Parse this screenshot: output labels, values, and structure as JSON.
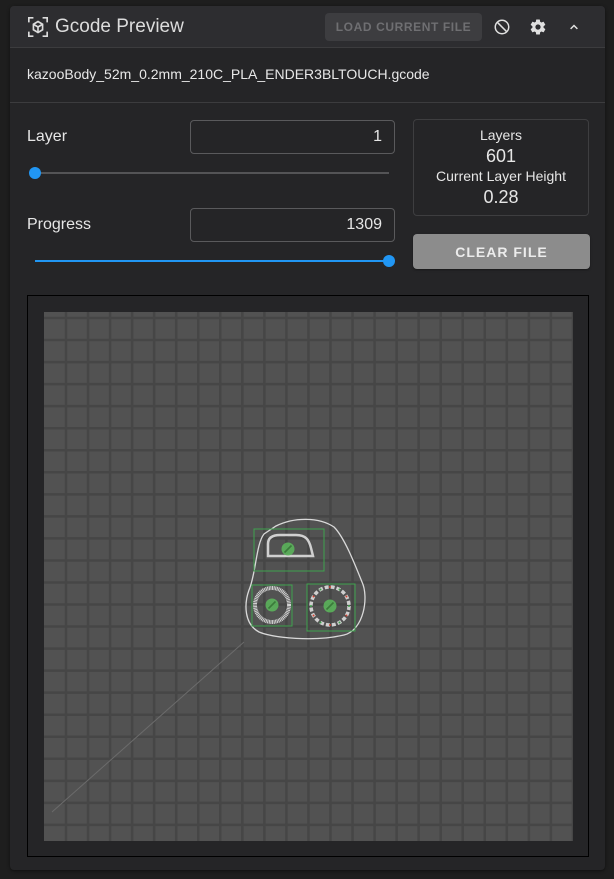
{
  "toolbar": {
    "title": "Gcode Preview",
    "title_icon": "cube-focus-icon",
    "load_button": "LOAD CURRENT FILE",
    "icons": [
      "cancel-icon",
      "gear-icon",
      "chevron-up-icon"
    ]
  },
  "file": {
    "name": "kazooBody_52m_0.2mm_210C_PLA_ENDER3BLTOUCH.gcode"
  },
  "layer": {
    "label": "Layer",
    "value": "1",
    "slider_fraction": 0.0
  },
  "progress": {
    "label": "Progress",
    "value": "1309",
    "slider_fraction": 1.0
  },
  "stats": {
    "layers_label": "Layers",
    "layers_value": "601",
    "height_label": "Current Layer Height",
    "height_value": "0.28"
  },
  "clear_button": "CLEAR FILE",
  "colors": {
    "accent": "#2196f3",
    "bed": "#525252",
    "grid_line": "#464646",
    "extrusion": "#d9d9d9",
    "object_box": "#3fa34d",
    "object_marker": "#5cb85c"
  },
  "preview": {
    "objects": [
      {
        "name": "top-object",
        "shape": "rounded-trapezoid"
      },
      {
        "name": "left-ring",
        "shape": "ring"
      },
      {
        "name": "right-gear",
        "shape": "gear-ring"
      }
    ]
  }
}
